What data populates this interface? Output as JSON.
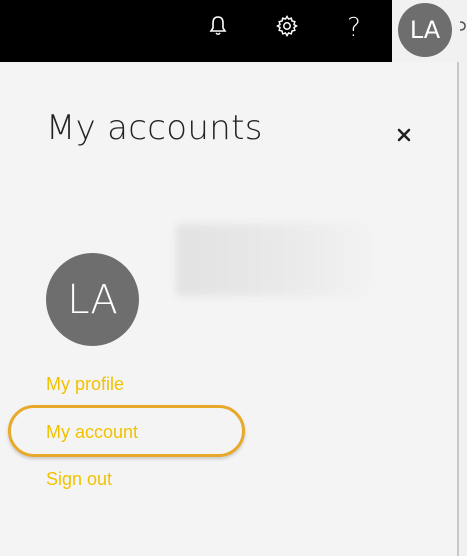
{
  "header": {
    "notifications_icon": "bell-icon",
    "settings_icon": "gear-icon",
    "help_glyph": "?",
    "avatar_initials": "LA"
  },
  "panel": {
    "title": "My accounts",
    "close_glyph": "×",
    "avatar_initials": "LA",
    "menu": {
      "my_profile": "My profile",
      "my_account": "My account",
      "sign_out": "Sign out"
    }
  },
  "colors": {
    "topbar": "#000000",
    "panel_bg": "#f4f4f4",
    "link": "#f2c200",
    "highlight_ring": "#e8a82a",
    "avatar_bg": "#6e6e6e"
  }
}
